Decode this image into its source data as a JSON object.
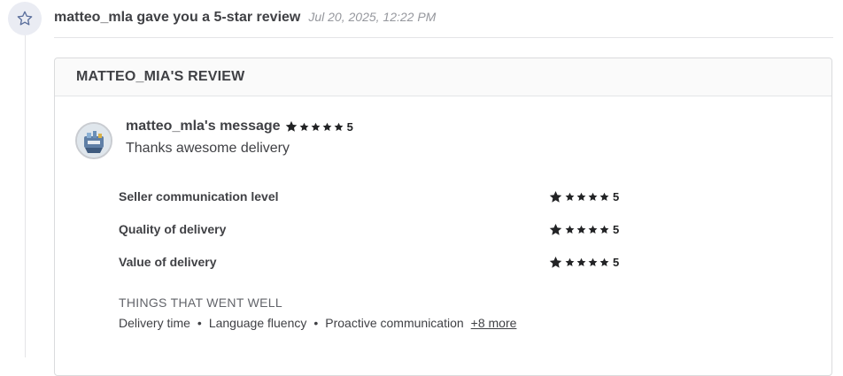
{
  "event": {
    "title": "matteo_mla gave you a 5-star review",
    "timestamp": "Jul 20, 2025, 12:22 PM",
    "icon": "star-outline-icon"
  },
  "card": {
    "title": "MATTEO_MIA'S REVIEW",
    "avatar_icon": "user-avatar",
    "message_author": "matteo_mla's message",
    "message_score": "5",
    "message_rating": 5,
    "message_text": "Thanks awesome delivery"
  },
  "ratings": [
    {
      "label": "Seller communication level",
      "score": "5",
      "stars": 5
    },
    {
      "label": "Quality of delivery",
      "score": "5",
      "stars": 5
    },
    {
      "label": "Value of delivery",
      "score": "5",
      "stars": 5
    }
  ],
  "went_well": {
    "title": "THINGS THAT WENT WELL",
    "items": [
      "Delivery time",
      "Language fluency",
      "Proactive communication"
    ],
    "separator": "•",
    "more_label": "+8 more"
  },
  "colors": {
    "star": "#222325",
    "icon_bg": "#eaecf3",
    "icon_stroke": "#5a6e9c"
  }
}
